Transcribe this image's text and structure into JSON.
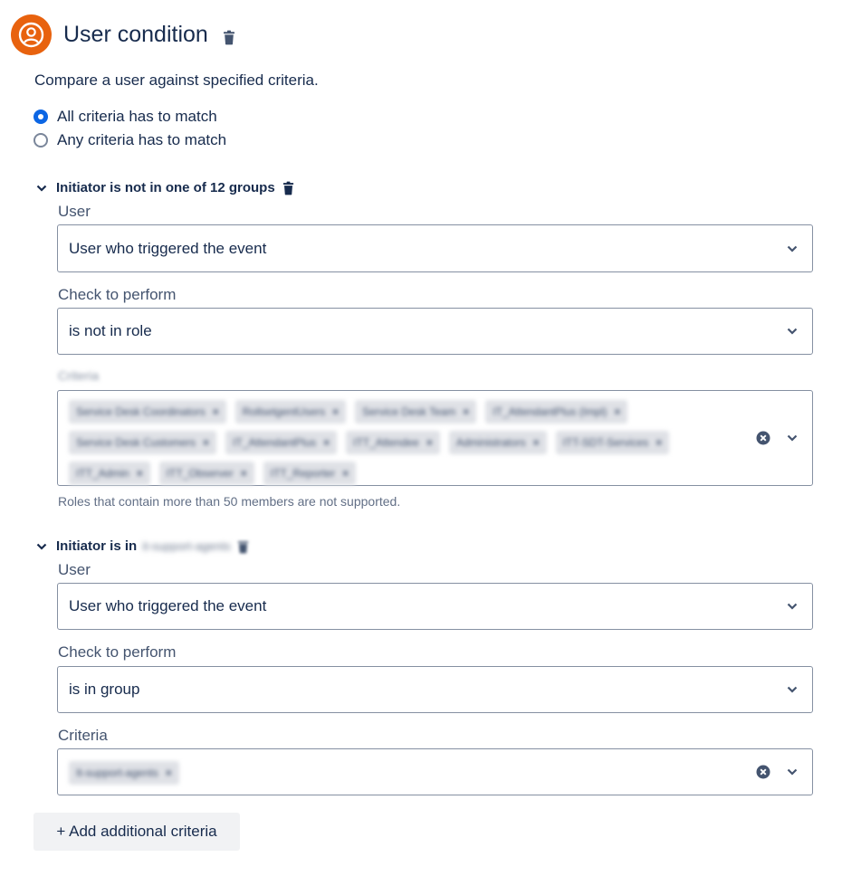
{
  "header": {
    "title": "User condition",
    "icon": "user-avatar-icon",
    "accent": "#e8620e"
  },
  "description": "Compare a user against specified criteria.",
  "match_options": [
    {
      "label": "All criteria has to match",
      "selected": true
    },
    {
      "label": "Any criteria has to match",
      "selected": false
    }
  ],
  "criteria": [
    {
      "title": "Initiator is not in one of 12 groups",
      "user_label": "User",
      "user_value": "User who triggered the event",
      "check_label": "Check to perform",
      "check_value": "is not in role",
      "criteria_label": "Criteria",
      "tags": [
        "Service Desk Coordinators",
        "RollsetgentUsers",
        "Service Desk Team",
        "IT_AttendantPlus (Impl)",
        "Service Desk Customers",
        "IT_AttendantPlus",
        "ITT_Attendee",
        "Administrators",
        "ITT-SDT-Services",
        "ITT_Admin",
        "ITT_Observer",
        "ITT_Reporter"
      ],
      "helper": "Roles that contain more than 50 members are not supported."
    },
    {
      "title_prefix": "Initiator is in",
      "title_group": "it-support-agents",
      "user_label": "User",
      "user_value": "User who triggered the event",
      "check_label": "Check to perform",
      "check_value": "is in group",
      "criteria_label": "Criteria",
      "tags": [
        "It-support-agents"
      ]
    }
  ],
  "add_button": "+ Add additional criteria"
}
